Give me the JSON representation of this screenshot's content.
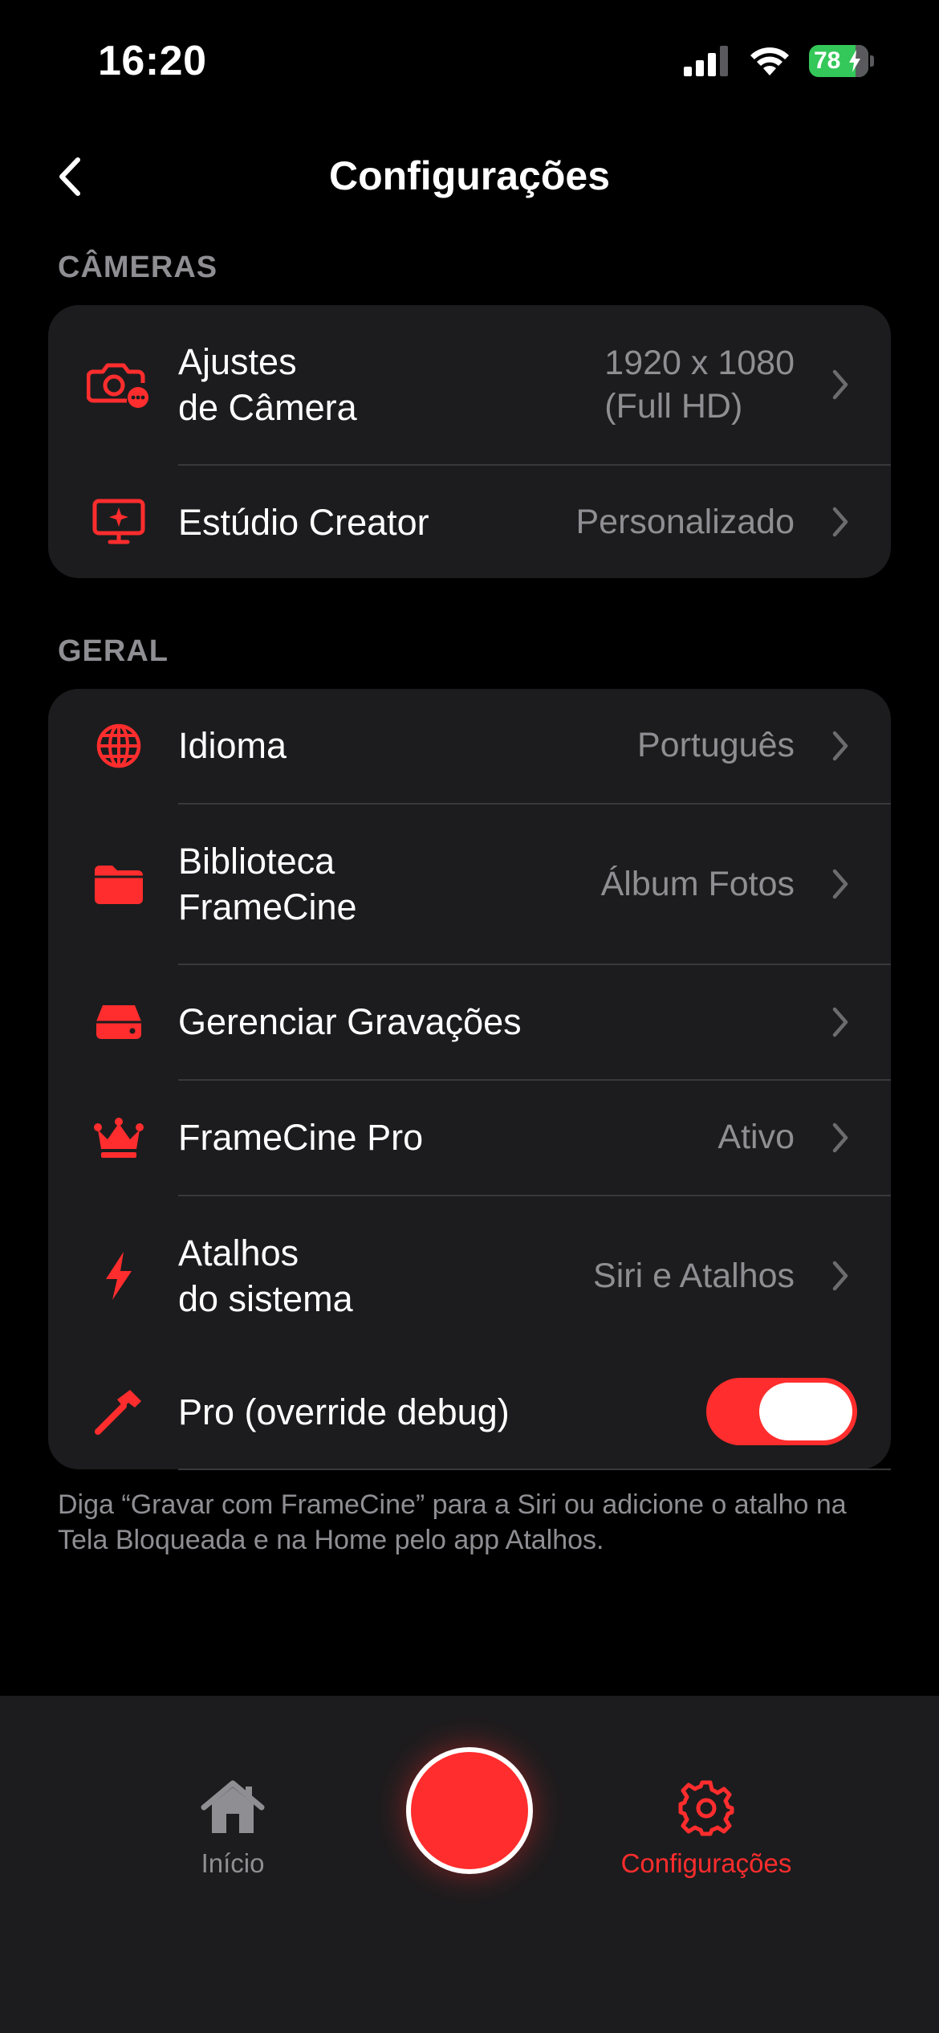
{
  "status_bar": {
    "time": "16:20",
    "battery": "78"
  },
  "header": {
    "title": "Configurações",
    "back_icon": "chevron-left-icon"
  },
  "sections": {
    "cameras": {
      "title": "CÂMERAS",
      "items": [
        {
          "label": "Ajustes\nde Câmera",
          "value": "1920 x 1080\n(Full HD)",
          "icon": "camera-settings-icon"
        },
        {
          "label": "Estúdio Creator",
          "value": "Personalizado",
          "icon": "monitor-sparkle-icon"
        }
      ]
    },
    "general": {
      "title": "GERAL",
      "items": [
        {
          "label": "Idioma",
          "value": "Português",
          "icon": "globe-icon"
        },
        {
          "label": "Biblioteca\nFrameCine",
          "value": "Álbum Fotos",
          "icon": "folder-icon"
        },
        {
          "label": "Gerenciar Gravações",
          "value": "",
          "icon": "drive-icon"
        },
        {
          "label": "FrameCine Pro",
          "value": "Ativo",
          "icon": "crown-icon"
        },
        {
          "label": "Atalhos\ndo sistema",
          "value": "Siri e Atalhos",
          "icon": "bolt-icon"
        },
        {
          "label": "Pro (override debug)",
          "toggle_on": true,
          "icon": "hammer-icon"
        }
      ]
    }
  },
  "footer_note": "Diga “Gravar com FrameCine” para a Siri ou adicione o atalho na Tela Bloqueada e na Home pelo app Atalhos.",
  "tab_bar": {
    "home_label": "Início",
    "settings_label": "Configurações",
    "selected": "settings"
  },
  "colors": {
    "accent": "#ff2d2d",
    "background": "#000000",
    "group_background": "#1c1c1e",
    "secondary_text": "#8e8e93",
    "battery": "#34c759"
  }
}
